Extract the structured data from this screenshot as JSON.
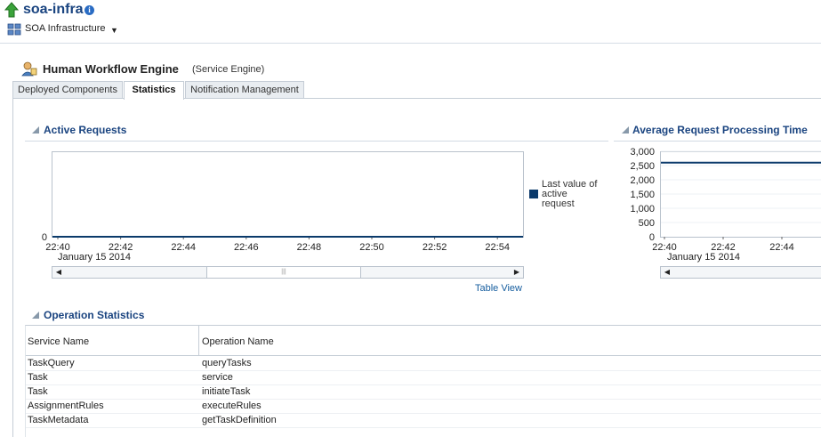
{
  "header": {
    "title": "soa-infra",
    "menu_label": "SOA Infrastructure"
  },
  "engine": {
    "title": "Human Workflow Engine",
    "type": "(Service Engine)"
  },
  "tabs": [
    {
      "label": "Deployed Components"
    },
    {
      "label": "Statistics"
    },
    {
      "label": "Notification Management"
    }
  ],
  "active_requests": {
    "title": "Active Requests",
    "legend": [
      "Last value of",
      "active",
      "request"
    ],
    "date_label": "January 15 2014",
    "table_view_link": "Table View"
  },
  "avg_time": {
    "title": "Average Request Processing Time",
    "date_label": "January 15 2014"
  },
  "operations": {
    "title": "Operation Statistics",
    "columns": [
      "Service Name",
      "Operation Name"
    ],
    "rows": [
      [
        "TaskQuery",
        "queryTasks"
      ],
      [
        "Task",
        "service"
      ],
      [
        "Task",
        "initiateTask"
      ],
      [
        "AssignmentRules",
        "executeRules"
      ],
      [
        "TaskMetadata",
        "getTaskDefinition"
      ]
    ]
  },
  "chart_data": [
    {
      "type": "line",
      "title": "Active Requests",
      "x_ticks": [
        "22:40",
        "22:42",
        "22:44",
        "22:46",
        "22:48",
        "22:50",
        "22:52",
        "22:54"
      ],
      "y_ticks": [
        "0"
      ],
      "series": [
        {
          "name": "Last value of active request",
          "x": [
            "22:40",
            "22:55"
          ],
          "values": [
            0,
            0
          ]
        }
      ],
      "ylim": [
        0,
        1
      ],
      "color": "#0b3a6b"
    },
    {
      "type": "line",
      "title": "Average Request Processing Time",
      "x_ticks": [
        "22:40",
        "22:42",
        "22:44"
      ],
      "y_ticks": [
        "0",
        "500",
        "1,000",
        "1,500",
        "2,000",
        "2,500",
        "3,000"
      ],
      "series": [
        {
          "values": [
            2600,
            2600
          ]
        }
      ],
      "ylim": [
        0,
        3000
      ],
      "color": "#0b3a6b"
    }
  ]
}
